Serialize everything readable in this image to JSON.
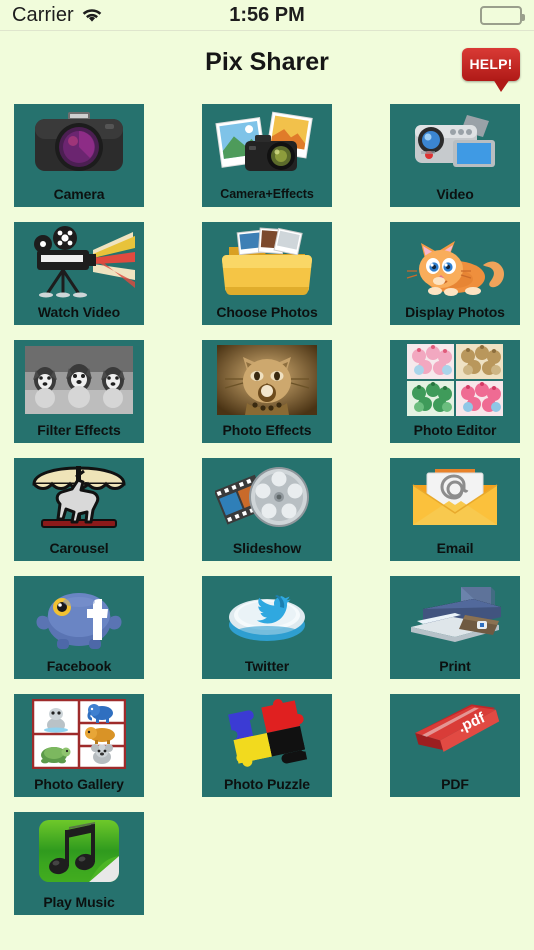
{
  "status_bar": {
    "carrier": "Carrier",
    "wifi_icon": "wifi-icon",
    "time": "1:56 PM",
    "battery_icon": "battery-full-icon"
  },
  "nav": {
    "title": "Pix Sharer",
    "help_label": "HELP!",
    "help_icon": "speech-bubble-icon"
  },
  "theme": {
    "background": "#f1fcdb",
    "tile_background": "#26726e",
    "title_color": "#161616",
    "label_color": "#0c1110",
    "help_red": "#b01a17"
  },
  "grid": {
    "columns": 3,
    "tiles": [
      {
        "label": "Camera",
        "icon": "camera-icon"
      },
      {
        "label": "Camera+Effects",
        "icon": "camera-photos-icon"
      },
      {
        "label": "Video",
        "icon": "camcorder-icon"
      },
      {
        "label": "Watch Video",
        "icon": "film-projector-icon"
      },
      {
        "label": "Choose Photos",
        "icon": "photo-folder-icon"
      },
      {
        "label": "Display Photos",
        "icon": "cat-icon"
      },
      {
        "label": "Filter Effects",
        "icon": "grayscale-dogs-icon"
      },
      {
        "label": "Photo Effects",
        "icon": "sepia-cat-icon"
      },
      {
        "label": "Photo Editor",
        "icon": "cupcakes-quad-icon"
      },
      {
        "label": "Carousel",
        "icon": "carousel-horse-icon"
      },
      {
        "label": "Slideshow",
        "icon": "film-reel-icon"
      },
      {
        "label": "Email",
        "icon": "envelope-at-icon"
      },
      {
        "label": "Facebook",
        "icon": "facebook-icon"
      },
      {
        "label": "Twitter",
        "icon": "twitter-bird-icon"
      },
      {
        "label": "Print",
        "icon": "printer-icon"
      },
      {
        "label": "Photo Gallery",
        "icon": "animal-grid-icon"
      },
      {
        "label": "Photo Puzzle",
        "icon": "puzzle-pieces-icon"
      },
      {
        "label": "PDF",
        "icon": "pdf-book-icon"
      },
      {
        "label": "Play Music",
        "icon": "music-note-icon"
      }
    ]
  }
}
